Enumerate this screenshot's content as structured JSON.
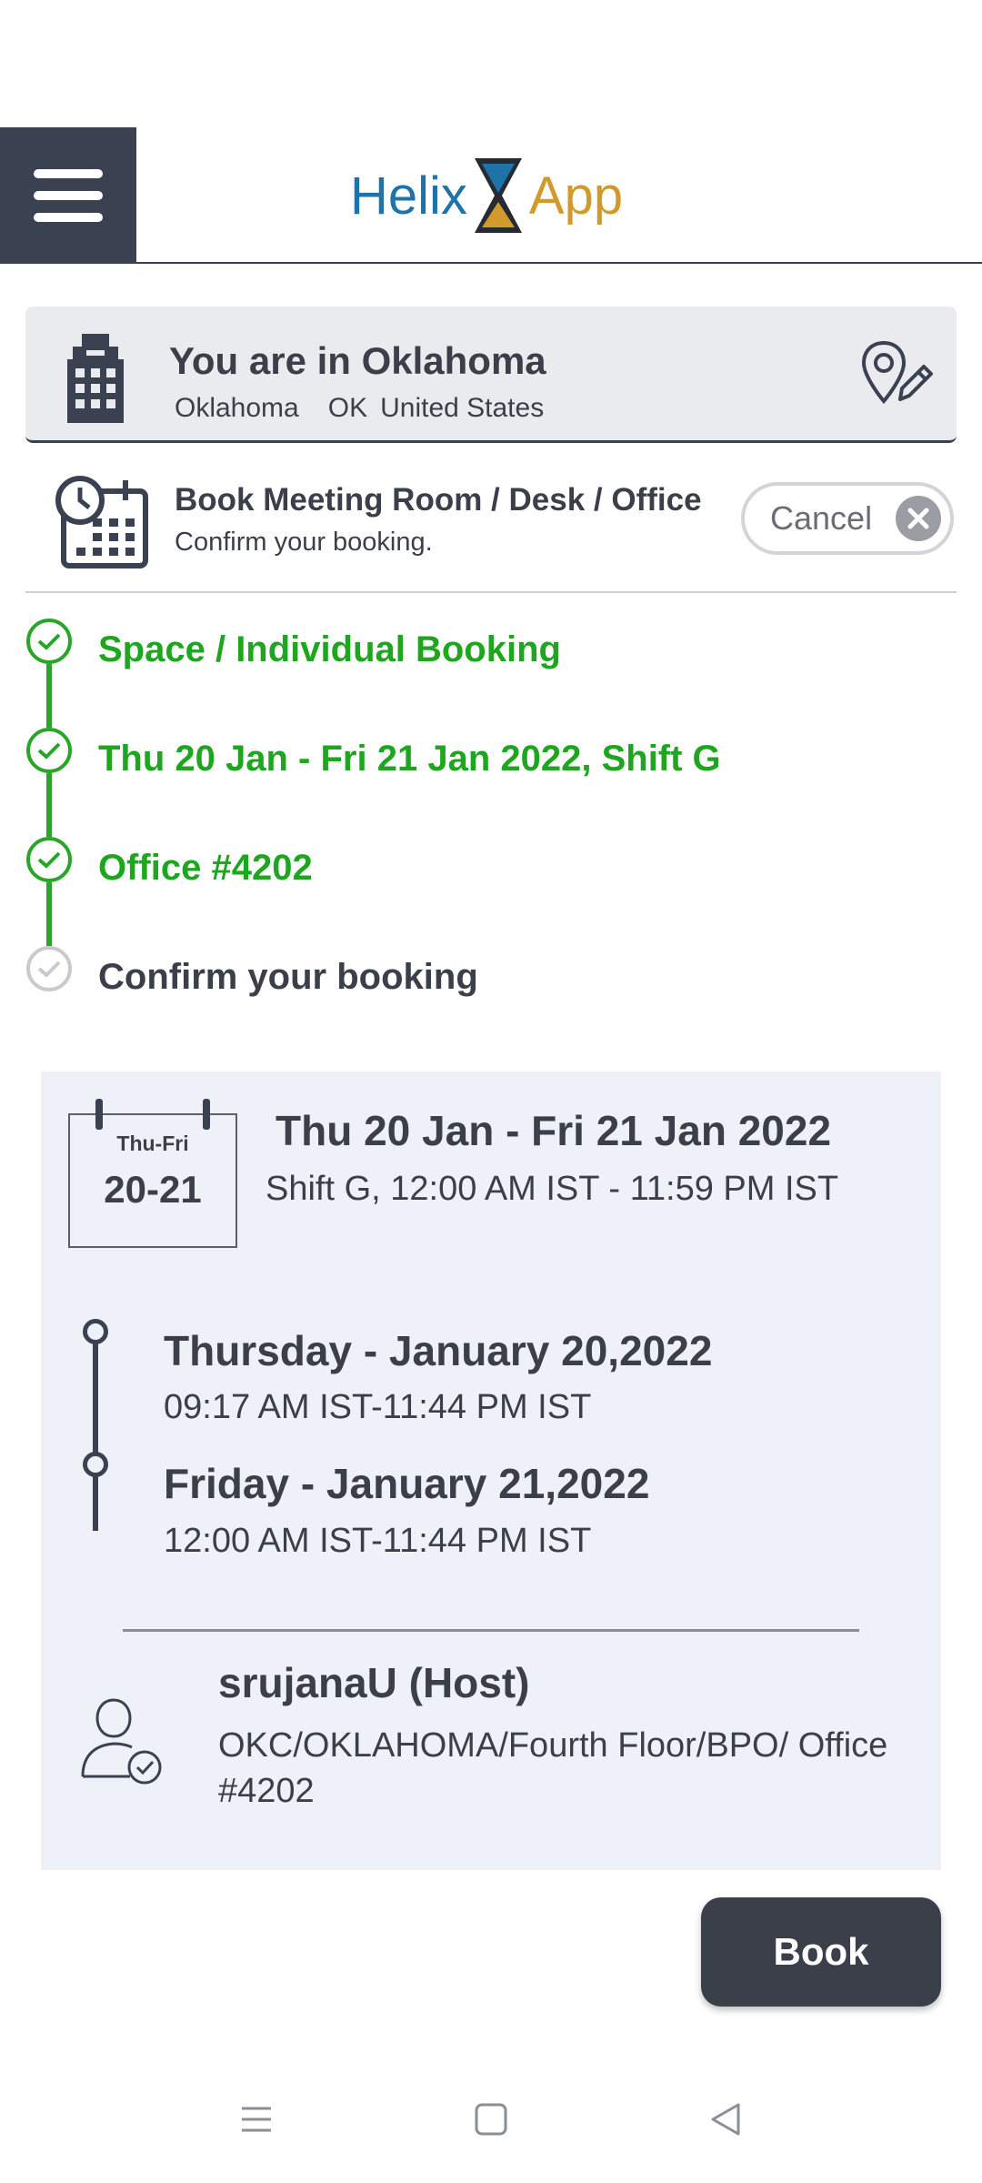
{
  "header": {
    "logo_left": "Helix",
    "logo_right": "App",
    "colors": {
      "logo_blue": "#1e73a8",
      "logo_gold": "#d19a2a",
      "dark": "#3a4150"
    }
  },
  "location": {
    "title": "You are in Oklahoma",
    "city": "Oklahoma",
    "state": "OK",
    "country": "United States"
  },
  "booking": {
    "title": "Book Meeting Room / Desk / Office",
    "subtitle": "Confirm your booking.",
    "cancel_label": "Cancel"
  },
  "steps": [
    {
      "label": "Space / Individual Booking",
      "status": "done"
    },
    {
      "label": "Thu 20 Jan - Fri 21 Jan 2022, Shift G",
      "status": "done"
    },
    {
      "label": "Office #4202",
      "status": "done"
    },
    {
      "label": "Confirm your booking",
      "status": "pending"
    }
  ],
  "summary": {
    "calendar_days": "Thu-Fri",
    "calendar_range": "20-21",
    "title": "Thu 20 Jan - Fri 21 Jan 2022",
    "subtitle": "Shift G, 12:00 AM IST - 11:59 PM IST",
    "days": [
      {
        "title": "Thursday - January 20,2022",
        "time": "09:17 AM IST-11:44 PM IST"
      },
      {
        "title": "Friday - January 21,2022",
        "time": "12:00 AM IST-11:44 PM IST"
      }
    ],
    "host_name": "srujanaU (Host)",
    "host_path": "OKC/OKLAHOMA/Fourth Floor/BPO/ Office #4202"
  },
  "actions": {
    "book_label": "Book"
  },
  "system_nav": {
    "icons": [
      "menu-icon",
      "home-square-icon",
      "back-triangle-icon"
    ]
  },
  "status_colors": {
    "done": "#2aa52a",
    "pending": "#c8cacd"
  }
}
